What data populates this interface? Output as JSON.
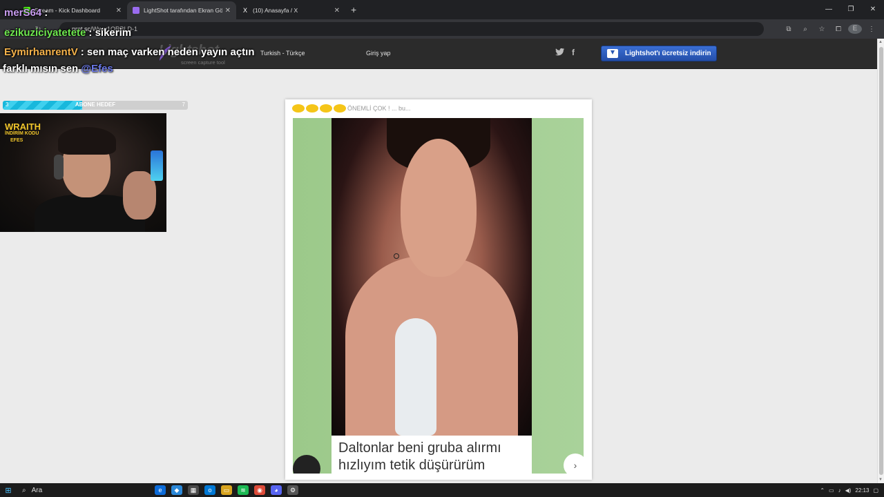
{
  "browser": {
    "tabs": [
      {
        "label": "Stream - Kick Dashboard",
        "favicon_color": "#53fc18"
      },
      {
        "label": "LightShot tarafından Ekran Gör",
        "favicon_color": "#9a6cf0"
      },
      {
        "label": "(10) Anasayfa / X",
        "favicon_color": "#ffffff"
      }
    ],
    "new_tab": "+",
    "url_host": "prnt.sc",
    "url_path": "/Www1QRBLD-1"
  },
  "lightshot": {
    "logo": "Lightshot",
    "tagline": "screen capture tool",
    "language": "Turkish - Türkçe",
    "login": "Giriş yap",
    "twitter": "twitter-icon",
    "facebook": "f",
    "download_button": "Lightshot'ı ücretsiz indirin"
  },
  "screenshot": {
    "top_text": "ÖNEMLİ ÇOK ! ... bu...",
    "caption_line1": "Daltonlar beni gruba alırmı",
    "caption_line2": "hızlıyım tetik düşürürüm"
  },
  "stream": {
    "chat": [
      {
        "user": "merS64",
        "sep": ":",
        "msg": "",
        "user_color": "#c89cf0"
      },
      {
        "user": "ezikuziciyatetete",
        "sep": ":",
        "msg": "sikerim",
        "user_color": "#6ee84e"
      },
      {
        "user": "EymirhanrentV",
        "sep": ":",
        "msg": "sen maç varken neden yayın açtın",
        "user_color": "#f5b24a"
      }
    ],
    "chat_continuation": "farklı mısın sen",
    "mention": "@Efes",
    "goal": {
      "label": "ABONE HEDEF",
      "current": "3",
      "target": "7",
      "fraction": 0.43
    },
    "webcam_overlay_line1": "WRAITH",
    "webcam_overlay_line2": "İNDİRİM KODU",
    "webcam_overlay_line3": "EFES"
  },
  "taskbar": {
    "search": "Ara",
    "time": "22:13"
  }
}
